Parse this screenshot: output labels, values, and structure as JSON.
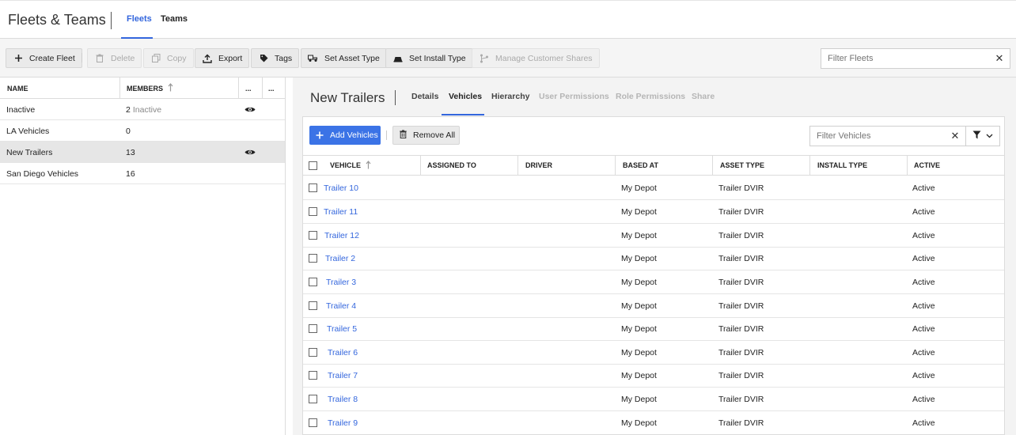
{
  "app": {
    "title": "Fleets & Teams"
  },
  "nav": {
    "tabs": [
      {
        "label": "Fleets",
        "active": true
      },
      {
        "label": "Teams",
        "active": false
      }
    ]
  },
  "toolbar": {
    "create_fleet": "Create Fleet",
    "delete": "Delete",
    "copy": "Copy",
    "export": "Export",
    "tags": "Tags",
    "set_asset_type": "Set Asset Type",
    "set_install_type": "Set Install Type",
    "manage_customer_shares": "Manage Customer Shares",
    "filter_fleets_placeholder": "Filter Fleets"
  },
  "fleet_list": {
    "columns": {
      "name": "NAME",
      "members": "MEMBERS",
      "more1": "...",
      "more2": "..."
    },
    "rows": [
      {
        "name": "Inactive",
        "members": "2",
        "members_note": "Inactive",
        "visible_icon": true,
        "selected": false
      },
      {
        "name": "LA Vehicles",
        "members": "0",
        "members_note": "",
        "visible_icon": false,
        "selected": false
      },
      {
        "name": "New Trailers",
        "members": "13",
        "members_note": "",
        "visible_icon": true,
        "selected": true
      },
      {
        "name": "San Diego Vehicles",
        "members": "16",
        "members_note": "",
        "visible_icon": false,
        "selected": false
      }
    ]
  },
  "detail": {
    "title": "New Trailers",
    "tabs": [
      {
        "label": "Details",
        "state": "normal"
      },
      {
        "label": "Vehicles",
        "state": "active"
      },
      {
        "label": "Hierarchy",
        "state": "normal"
      },
      {
        "label": "User Permissions",
        "state": "disabled"
      },
      {
        "label": "Role Permissions",
        "state": "disabled"
      },
      {
        "label": "Share",
        "state": "disabled"
      }
    ],
    "add_vehicles": "Add Vehicles",
    "remove_all": "Remove All",
    "filter_vehicles_placeholder": "Filter Vehicles",
    "columns": {
      "vehicle": "VEHICLE",
      "assigned_to": "ASSIGNED TO",
      "driver": "DRIVER",
      "based_at": "BASED AT",
      "asset_type": "ASSET TYPE",
      "install_type": "INSTALL TYPE",
      "active": "ACTIVE"
    },
    "vehicles": [
      {
        "vehicle": "Trailer 10",
        "assigned_to": "",
        "driver": "",
        "based_at": "My Depot",
        "asset_type": "Trailer DVIR",
        "install_type": "",
        "active": "Active"
      },
      {
        "vehicle": "Trailer 11",
        "assigned_to": "",
        "driver": "",
        "based_at": "My Depot",
        "asset_type": "Trailer DVIR",
        "install_type": "",
        "active": "Active"
      },
      {
        "vehicle": "Trailer 12",
        "assigned_to": "",
        "driver": "",
        "based_at": "My Depot",
        "asset_type": "Trailer DVIR",
        "install_type": "",
        "active": "Active"
      },
      {
        "vehicle": "Trailer 2",
        "assigned_to": "",
        "driver": "",
        "based_at": "My Depot",
        "asset_type": "Trailer DVIR",
        "install_type": "",
        "active": "Active"
      },
      {
        "vehicle": "Trailer 3",
        "assigned_to": "",
        "driver": "",
        "based_at": "My Depot",
        "asset_type": "Trailer DVIR",
        "install_type": "",
        "active": "Active"
      },
      {
        "vehicle": "Trailer 4",
        "assigned_to": "",
        "driver": "",
        "based_at": "My Depot",
        "asset_type": "Trailer DVIR",
        "install_type": "",
        "active": "Active"
      },
      {
        "vehicle": "Trailer 5",
        "assigned_to": "",
        "driver": "",
        "based_at": "My Depot",
        "asset_type": "Trailer DVIR",
        "install_type": "",
        "active": "Active"
      },
      {
        "vehicle": "Trailer 6",
        "assigned_to": "",
        "driver": "",
        "based_at": "My Depot",
        "asset_type": "Trailer DVIR",
        "install_type": "",
        "active": "Active"
      },
      {
        "vehicle": "Trailer 7",
        "assigned_to": "",
        "driver": "",
        "based_at": "My Depot",
        "asset_type": "Trailer DVIR",
        "install_type": "",
        "active": "Active"
      },
      {
        "vehicle": "Trailer 8",
        "assigned_to": "",
        "driver": "",
        "based_at": "My Depot",
        "asset_type": "Trailer DVIR",
        "install_type": "",
        "active": "Active"
      },
      {
        "vehicle": "Trailer 9",
        "assigned_to": "",
        "driver": "",
        "based_at": "My Depot",
        "asset_type": "Trailer DVIR",
        "install_type": "",
        "active": "Active"
      }
    ]
  },
  "colors": {
    "accent": "#3366dd",
    "primary_button": "#3b73e6",
    "selected_row": "#e6e6e6"
  }
}
